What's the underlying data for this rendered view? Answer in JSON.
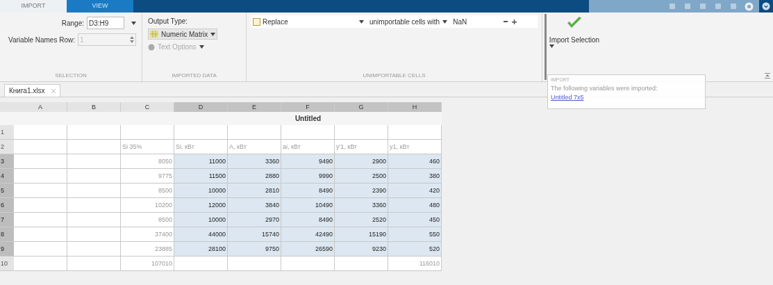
{
  "tabs": [
    {
      "label": "IMPORT",
      "selected": true
    },
    {
      "label": "VIEW",
      "selected": false
    }
  ],
  "toolstrip": {
    "selection": {
      "title": "SELECTION",
      "range_label": "Range:",
      "range_value": "D3:H9",
      "names_row_label": "Variable Names Row:",
      "names_row_value": "1",
      "names_row_disabled": true
    },
    "imported_data": {
      "title": "IMPORTED DATA",
      "output_type_label": "Output Type:",
      "output_type": "Numeric Matrix",
      "text_options": "Text Options",
      "text_options_disabled": true
    },
    "unimportable_cells": {
      "title": "UNIMPORTABLE CELLS",
      "rule": {
        "checked": false,
        "action": "Replace",
        "target": "unimportable cells with",
        "value": "NaN"
      }
    },
    "import_button": {
      "label": "Import Selection"
    }
  },
  "document_tab": {
    "label": "Книга1.xlsx"
  },
  "popup": {
    "title": "IMPORT",
    "message": "The following variables were imported:",
    "link": "Untitled 7x5"
  },
  "table": {
    "variable_name": "Untitled",
    "columns": [
      {
        "label": "A",
        "selected": false
      },
      {
        "label": "B",
        "selected": false
      },
      {
        "label": "C",
        "selected": false
      },
      {
        "label": "D",
        "selected": true
      },
      {
        "label": "E",
        "selected": true
      },
      {
        "label": "F",
        "selected": true
      },
      {
        "label": "G",
        "selected": true
      },
      {
        "label": "H",
        "selected": true
      }
    ],
    "rows": [
      {
        "number": "1",
        "selected": false,
        "cells": [
          null,
          null,
          null,
          null,
          null,
          null,
          null,
          null
        ]
      },
      {
        "number": "2",
        "selected": false,
        "cells": [
          null,
          null,
          "Si 35%",
          "Si, кВт",
          "A, кВт",
          "ai, кВт",
          "y'1, кВт",
          "y1, кВт"
        ]
      },
      {
        "number": "3",
        "selected": true,
        "cells": [
          null,
          null,
          "8050",
          "11000",
          "3360",
          "9490",
          "2900",
          "460"
        ]
      },
      {
        "number": "4",
        "selected": true,
        "cells": [
          null,
          null,
          "9775",
          "11500",
          "2880",
          "9990",
          "2500",
          "380"
        ]
      },
      {
        "number": "5",
        "selected": true,
        "cells": [
          null,
          null,
          "8500",
          "10000",
          "2810",
          "8490",
          "2390",
          "420"
        ]
      },
      {
        "number": "6",
        "selected": true,
        "cells": [
          null,
          null,
          "10200",
          "12000",
          "3840",
          "10490",
          "3360",
          "480"
        ]
      },
      {
        "number": "7",
        "selected": true,
        "cells": [
          null,
          null,
          "8500",
          "10000",
          "2970",
          "8490",
          "2520",
          "450"
        ]
      },
      {
        "number": "8",
        "selected": true,
        "cells": [
          null,
          null,
          "37400",
          "44000",
          "15740",
          "42490",
          "15190",
          "550"
        ]
      },
      {
        "number": "9",
        "selected": true,
        "cells": [
          null,
          null,
          "23885",
          "28100",
          "9750",
          "26590",
          "9230",
          "520"
        ]
      },
      {
        "number": "10",
        "selected": false,
        "cells": [
          null,
          null,
          "107010",
          null,
          null,
          null,
          null,
          "116010"
        ]
      }
    ]
  }
}
